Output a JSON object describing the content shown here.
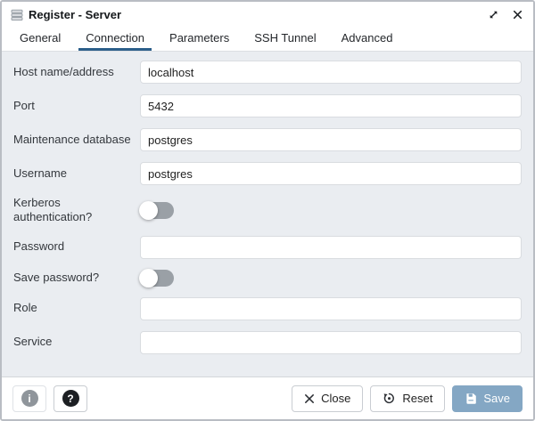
{
  "window": {
    "title": "Register - Server"
  },
  "tabs": [
    {
      "label": "General",
      "active": false
    },
    {
      "label": "Connection",
      "active": true
    },
    {
      "label": "Parameters",
      "active": false
    },
    {
      "label": "SSH Tunnel",
      "active": false
    },
    {
      "label": "Advanced",
      "active": false
    }
  ],
  "form": {
    "fields": [
      {
        "label": "Host name/address",
        "type": "text",
        "value": "localhost"
      },
      {
        "label": "Port",
        "type": "text",
        "value": "5432"
      },
      {
        "label": "Maintenance database",
        "type": "text",
        "value": "postgres"
      },
      {
        "label": "Username",
        "type": "text",
        "value": "postgres"
      },
      {
        "label": "Kerberos authentication?",
        "type": "toggle",
        "value": false
      },
      {
        "label": "Password",
        "type": "password",
        "value": ""
      },
      {
        "label": "Save password?",
        "type": "toggle",
        "value": false
      },
      {
        "label": "Role",
        "type": "text",
        "value": ""
      },
      {
        "label": "Service",
        "type": "text",
        "value": ""
      }
    ]
  },
  "footer": {
    "info_button": {
      "icon": "info-icon",
      "glyph": "i"
    },
    "help_button": {
      "icon": "help-icon",
      "glyph": "?"
    },
    "close_label": "Close",
    "reset_label": "Reset",
    "save_label": "Save"
  },
  "icons": {
    "titlebar": "server-icon",
    "maximize": "expand-icon",
    "close": "close-icon",
    "reset": "reset-history-icon",
    "save": "floppy-disk-icon"
  },
  "colors": {
    "accent": "#2c5f8a",
    "content_bg": "#eaedf1",
    "save_button_bg": "#84a7c4",
    "toggle_track": "#9aa0a6"
  }
}
